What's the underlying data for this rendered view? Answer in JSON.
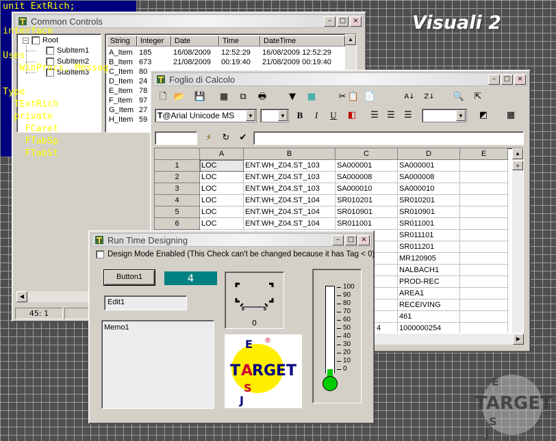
{
  "brand": {
    "title": "Visuali 2"
  },
  "common_controls": {
    "title": "Common Controls",
    "tree": {
      "root": "Root",
      "items": [
        "SubItem1",
        "SubItem2",
        "SubItem3"
      ]
    },
    "list": {
      "columns": [
        "String",
        "Integer",
        "Date",
        "Time",
        "DateTime"
      ],
      "rows": [
        [
          "A_Item",
          "185",
          "16/08/2009",
          "12:52:29",
          "16/08/2009 12:52:29"
        ],
        [
          "B_Item",
          "673",
          "21/08/2009",
          "00:19:40",
          "21/08/2009 00:19:40"
        ],
        [
          "C_Item",
          "80",
          "",
          "",
          ""
        ],
        [
          "D_Item",
          "24",
          "",
          "",
          ""
        ],
        [
          "E_Item",
          "78",
          "",
          "",
          ""
        ],
        [
          "F_Item",
          "97",
          "",
          "",
          ""
        ],
        [
          "G_Item",
          "27",
          "",
          "",
          ""
        ],
        [
          "H_Item",
          "59",
          "",
          "",
          ""
        ]
      ]
    },
    "code": [
      "unit ExtRich;",
      "",
      "interface",
      "",
      "Uses",
      "   WinProcs, Messag",
      "",
      "Type",
      "  TExtRich",
      "  private",
      "    FCaret",
      "    FTabSp",
      "    FTabSt"
    ],
    "status": "45: 1"
  },
  "foglio": {
    "title": "Foglio di Calcolo",
    "font_name": "@Arial Unicode MS",
    "columns": [
      "A",
      "B",
      "C",
      "D",
      "E"
    ],
    "row_numbers": [
      "1",
      "2",
      "3",
      "4",
      "5",
      "6"
    ],
    "rows": [
      [
        "LOC",
        "ENT.WH_Z04.ST_103",
        "SA000001",
        "SA000001",
        ""
      ],
      [
        "LOC",
        "ENT.WH_Z04.ST_103",
        "SA000008",
        "SA000008",
        ""
      ],
      [
        "LOC",
        "ENT.WH_Z04.ST_103",
        "SA000010",
        "SA000010",
        ""
      ],
      [
        "LOC",
        "ENT.WH_Z04.ST_104",
        "SR010201",
        "SR010201",
        ""
      ],
      [
        "LOC",
        "ENT.WH_Z04.ST_104",
        "SR010901",
        "SR010901",
        ""
      ],
      [
        "LOC",
        "ENT.WH_Z04.ST_104",
        "SR011001",
        "SR011001",
        ""
      ]
    ],
    "lower_d": [
      "SR011101",
      "SR011201",
      "MR120905",
      "NALBACH1",
      "PROD-REC",
      "AREA1",
      "RECEIVING",
      "461",
      "1000000254"
    ],
    "lower_c_last": "4",
    "toolbar_icons": [
      "new-icon",
      "open-icon",
      "save-icon",
      "table-icon",
      "copy-icon",
      "print-icon",
      "dropdown-icon",
      "grid-icon",
      "cut-icon",
      "paste-icon",
      "clipboard-icon",
      "sort-asc-icon",
      "sort-desc-icon",
      "find-icon",
      "pointer-icon"
    ],
    "format": {
      "bold": "B",
      "italic": "I",
      "underline": "U"
    }
  },
  "rtd": {
    "title": "Run Time Designing",
    "checkbox_label": "Design Mode Enabled (This Check can't be changed because it has Tag < 0)",
    "button1": "Button1",
    "counter": "4",
    "edit1": "Edit1",
    "memo1": "Memo1",
    "gauge_value": "0",
    "logo_text": "TARGET",
    "thermo_scale": [
      "100",
      "90",
      "80",
      "70",
      "60",
      "50",
      "40",
      "30",
      "20",
      "10",
      "0"
    ],
    "thermo_value": 0
  },
  "colors": {
    "code_bg": "#000080",
    "code_fg": "#ffff00",
    "counter_bg": "#008080",
    "thermo_fill": "#00cc00"
  }
}
